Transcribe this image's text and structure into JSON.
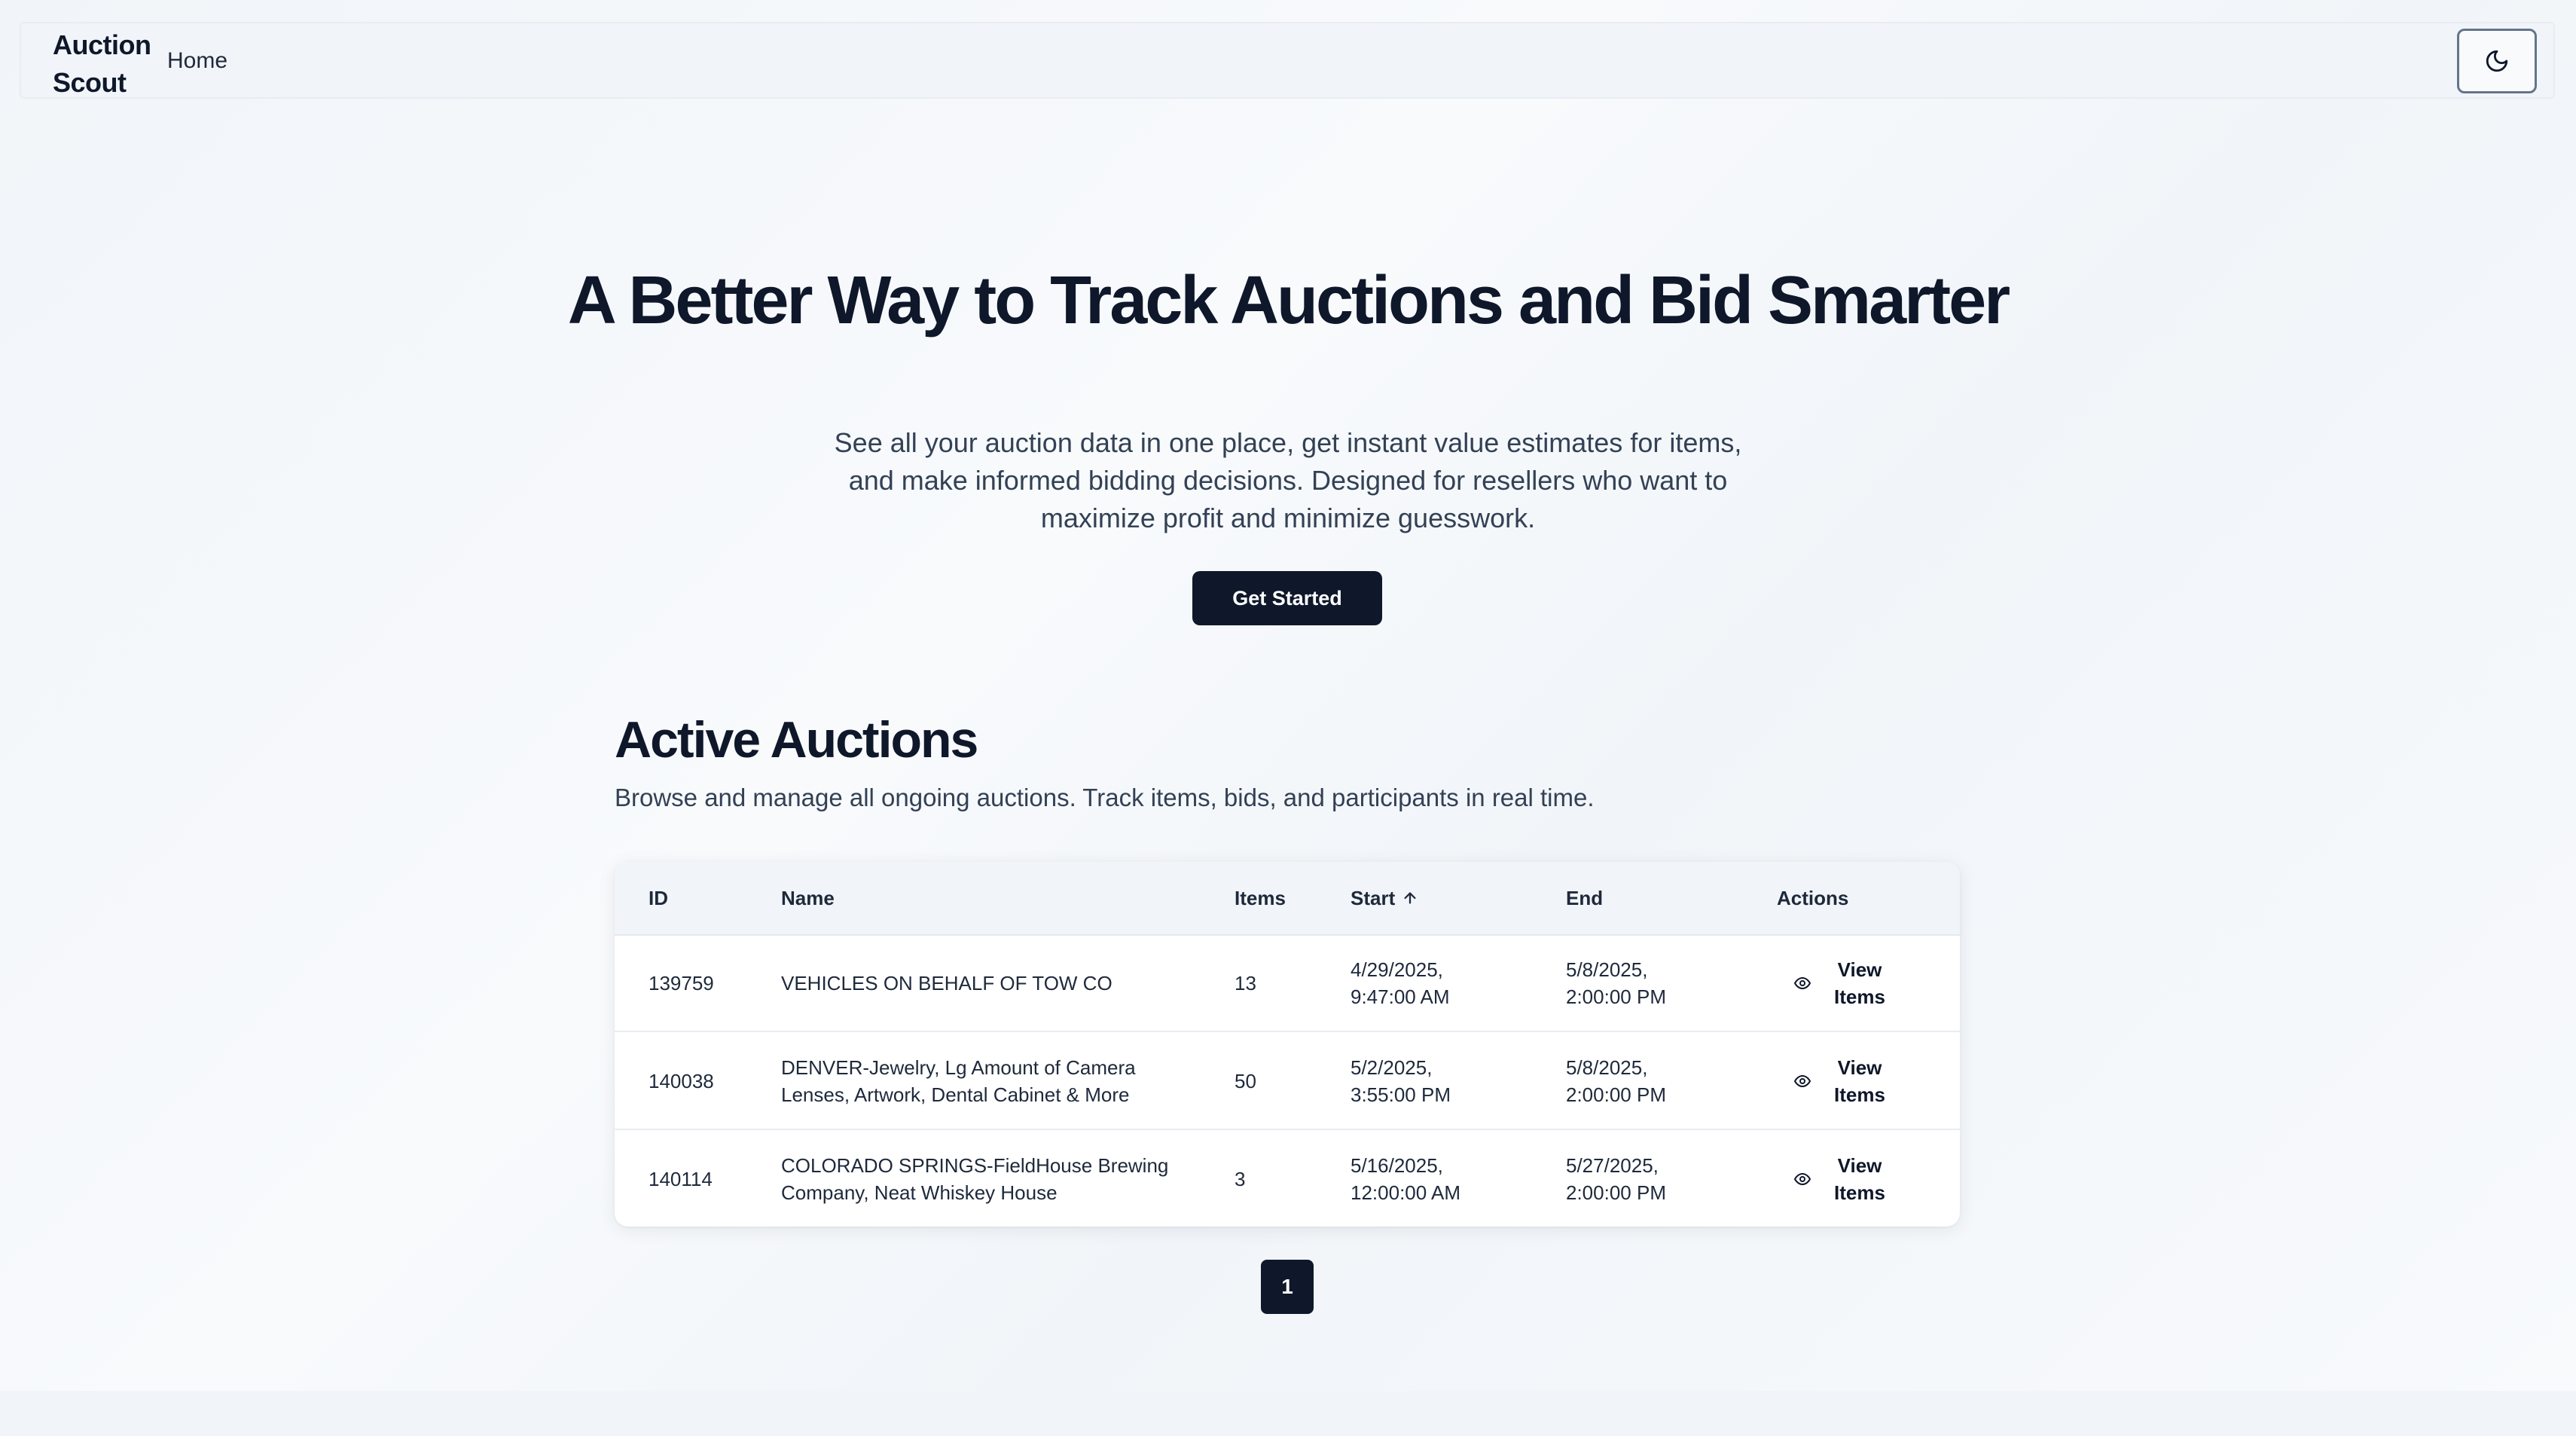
{
  "header": {
    "brand": "Auction Scout",
    "nav": [
      {
        "label": "Home"
      }
    ],
    "theme_toggle_icon": "moon-icon"
  },
  "hero": {
    "title": "A Better Way to Track Auctions and Bid Smarter",
    "subtitle": "See all your auction data in one place, get instant value estimates for items, and make informed bidding decisions. Designed for resellers who want to maximize profit and minimize guesswork.",
    "cta_label": "Get Started"
  },
  "auctions": {
    "title": "Active Auctions",
    "subtitle": "Browse and manage all ongoing auctions. Track items, bids, and participants in real time.",
    "columns": {
      "id": "ID",
      "name": "Name",
      "items": "Items",
      "start": "Start",
      "start_sort_icon": "arrow-up-icon",
      "end": "End",
      "actions": "Actions"
    },
    "rows": [
      {
        "id": "139759",
        "name": "VEHICLES ON BEHALF OF TOW CO",
        "items": "13",
        "start": "4/29/2025, 9:47:00 AM",
        "end": "5/8/2025, 2:00:00 PM",
        "action": "View Items",
        "action_icon": "eye-icon"
      },
      {
        "id": "140038",
        "name": "DENVER-Jewelry, Lg Amount of Camera Lenses, Artwork, Dental Cabinet & More",
        "items": "50",
        "start": "5/2/2025, 3:55:00 PM",
        "end": "5/8/2025, 2:00:00 PM",
        "action": "View Items",
        "action_icon": "eye-icon"
      },
      {
        "id": "140114",
        "name": "COLORADO SPRINGS-FieldHouse Brewing Company, Neat Whiskey House",
        "items": "3",
        "start": "5/16/2025, 12:00:00 AM",
        "end": "5/27/2025, 2:00:00 PM",
        "action": "View Items",
        "action_icon": "eye-icon"
      }
    ],
    "pagination": {
      "current_page": "1"
    }
  },
  "colors": {
    "primary": "#0f172a",
    "background": "#f8fafc",
    "muted_text": "#334155"
  }
}
